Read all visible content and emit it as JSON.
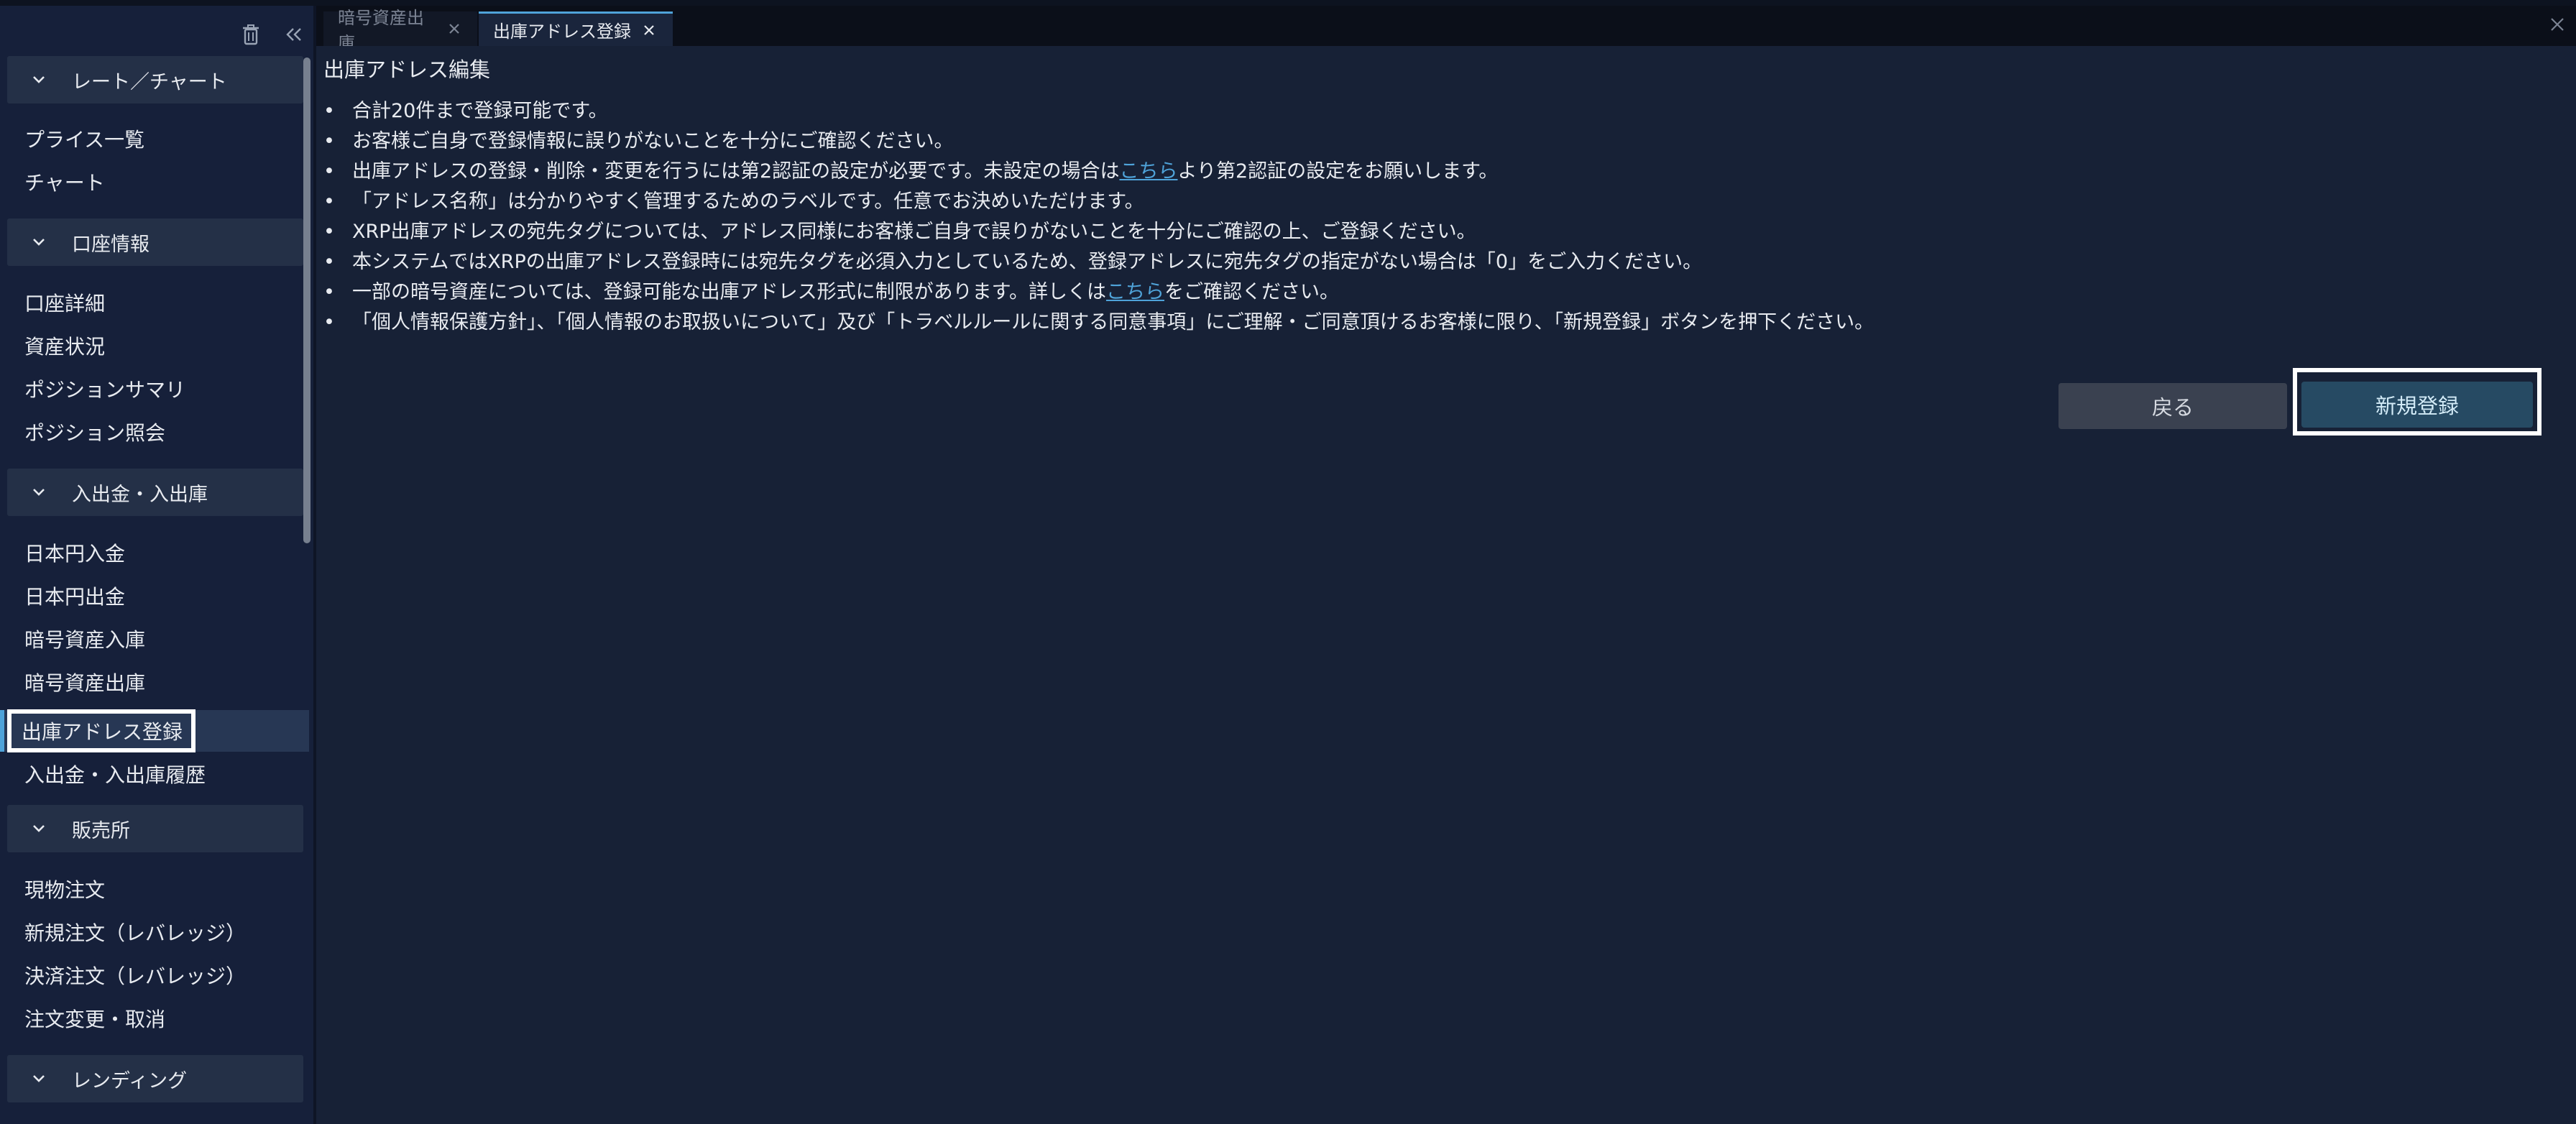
{
  "sidebar": {
    "tools": {
      "trash_icon": "trash-icon",
      "collapse_icon": "double-chevron-left-icon"
    },
    "sections": [
      {
        "label": "レート／チャート",
        "items": [
          "プライス一覧",
          "チャート"
        ]
      },
      {
        "label": "口座情報",
        "items": [
          "口座詳細",
          "資産状況",
          "ポジションサマリ",
          "ポジション照会"
        ]
      },
      {
        "label": "入出金・入出庫",
        "items": [
          "日本円入金",
          "日本円出金",
          "暗号資産入庫",
          "暗号資産出庫",
          "出庫アドレス登録",
          "入出金・入出庫履歴"
        ]
      },
      {
        "label": "販売所",
        "items": [
          "現物注文",
          "新規注文（レバレッジ）",
          "決済注文（レバレッジ）",
          "注文変更・取消"
        ]
      },
      {
        "label": "レンディング",
        "items": []
      }
    ],
    "active_item": "出庫アドレス登録"
  },
  "tabs": [
    {
      "label": "暗号資産出庫",
      "active": false
    },
    {
      "label": "出庫アドレス登録",
      "active": true
    }
  ],
  "main": {
    "title": "出庫アドレス編集",
    "notes": [
      {
        "text": "合計20件まで登録可能です。"
      },
      {
        "text": "お客様ご自身で登録情報に誤りがないことを十分にご確認ください。"
      },
      {
        "before": "出庫アドレスの登録・削除・変更を行うには第2認証の設定が必要です。未設定の場合は",
        "link": "こちら",
        "after": "より第2認証の設定をお願いします。"
      },
      {
        "text": "「アドレス名称」は分かりやすく管理するためのラベルです。任意でお決めいただけます。"
      },
      {
        "text": "XRP出庫アドレスの宛先タグについては、アドレス同様にお客様ご自身で誤りがないことを十分にご確認の上、ご登録ください。"
      },
      {
        "text": "本システムではXRPの出庫アドレス登録時には宛先タグを必須入力としているため、登録アドレスに宛先タグの指定がない場合は「0」をご入力ください。"
      },
      {
        "before": "一部の暗号資産については、登録可能な出庫アドレス形式に制限があります。詳しくは",
        "link": "こちら",
        "after": "をご確認ください。"
      },
      {
        "text": "「個人情報保護方針」、「個人情報のお取扱いについて」及び「トラベルルールに関する同意事項」にご理解・ご同意頂けるお客様に限り、「新規登録」ボタンを押下ください。"
      }
    ],
    "buttons": {
      "back": "戻る",
      "new": "新規登録"
    }
  },
  "colors": {
    "accent": "#4fa3d9",
    "background": "#172136",
    "sidebar": "#16203a"
  }
}
